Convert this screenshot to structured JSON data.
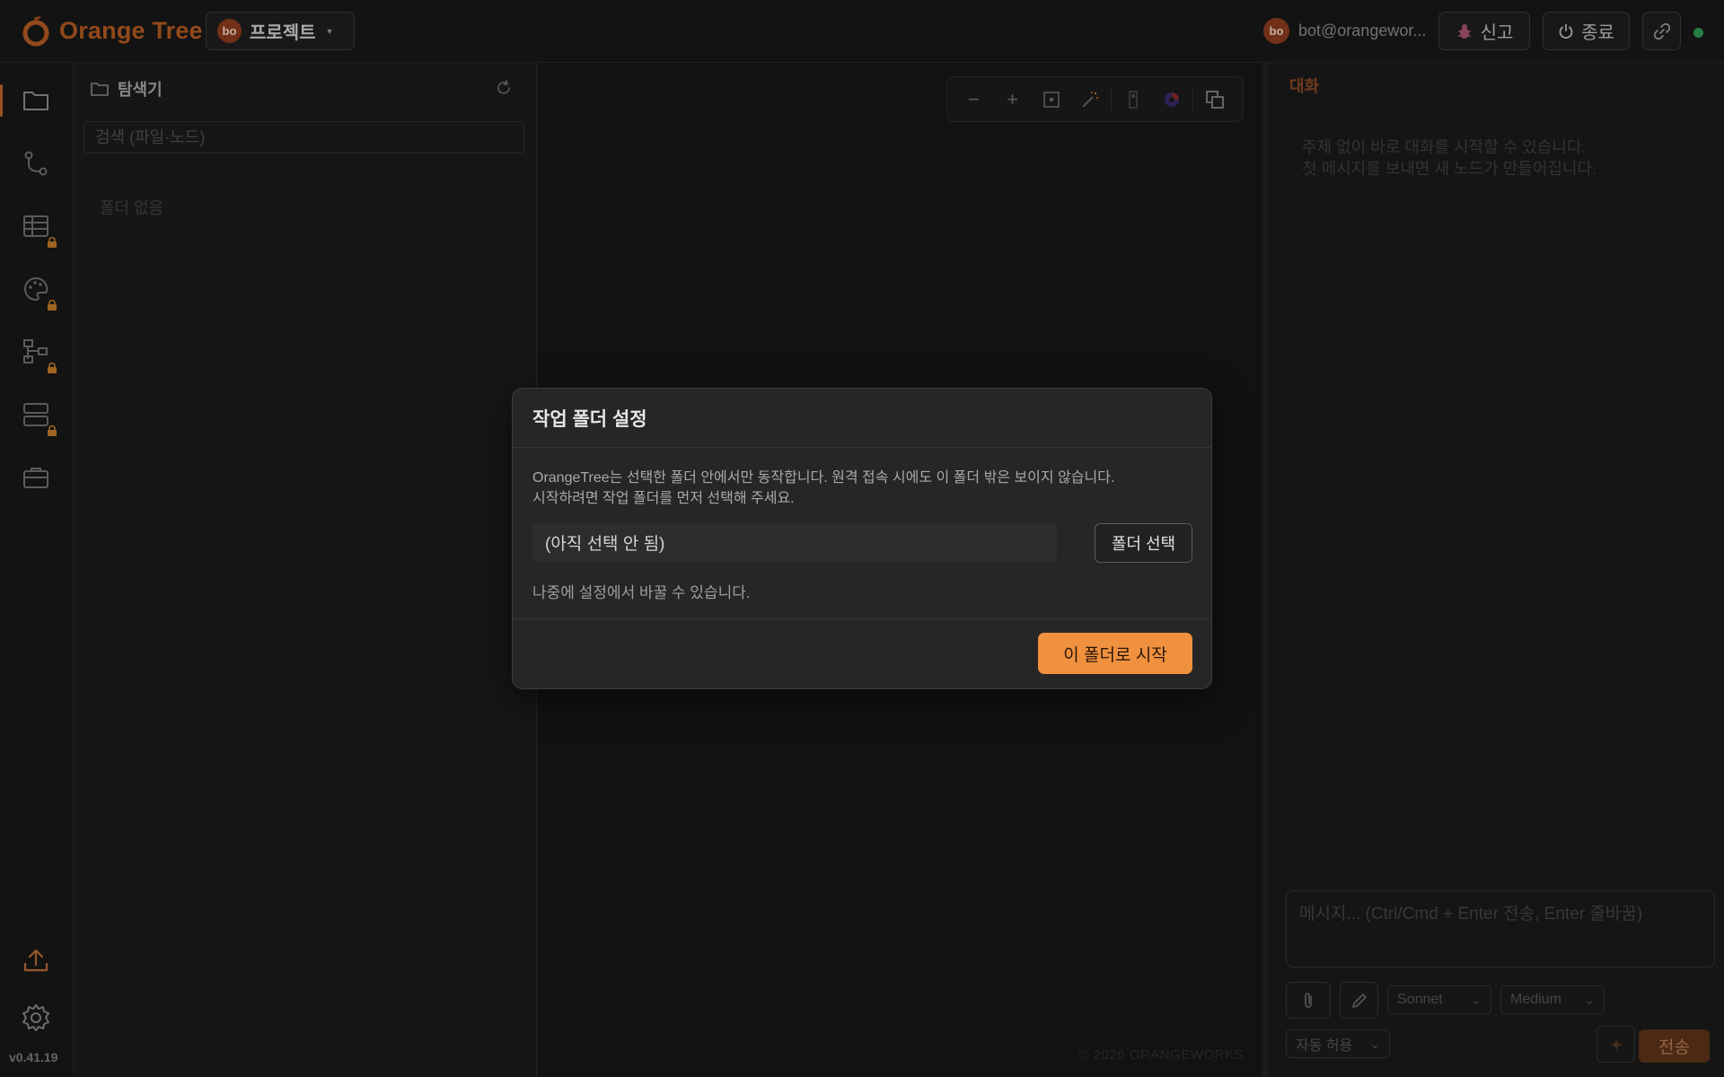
{
  "app": {
    "title": "Orange Tree",
    "version": "v0.41.19"
  },
  "header": {
    "project_avatar": "bo",
    "project_label": "프로젝트",
    "user_avatar": "bo",
    "user_email": "bot@orangewor...",
    "report_label": "신고",
    "exit_label": "종료",
    "status_color": "#2e9a55",
    "accent_color": "#b35a22"
  },
  "rail": {
    "items": [
      "folder-icon",
      "branch-icon",
      "table-icon",
      "palette-icon",
      "diagram-icon",
      "server-icon",
      "briefcase-icon"
    ],
    "bottom": [
      "upload-icon",
      "gear-icon"
    ]
  },
  "explorer": {
    "title": "탐색기",
    "search_placeholder": "검색 (파일·노드)",
    "empty_text": "폴더 없음"
  },
  "canvas": {
    "copyright": "© 2026 ORANGEWORKS"
  },
  "chat": {
    "title": "대화",
    "hint_line1": "주제 없이 바로 대화를 시작할 수 있습니다.",
    "hint_line2": "첫 메시지를 보내면 새 노드가 만들어집니다.",
    "input_placeholder": "메시지... (Ctrl/Cmd + Enter 전송, Enter 줄바꿈)",
    "model_value": "Sonnet",
    "effort_value": "Medium",
    "permission_value": "자동 허용",
    "send_label": "전송"
  },
  "modal": {
    "title": "작업 폴더 설정",
    "desc_line1": "OrangeTree는 선택한 폴더 안에서만 동작합니다. 원격 접속 시에도 이 폴더 밖은 보이지 않습니다.",
    "desc_line2": "시작하려면 작업 폴더를 먼저 선택해 주세요.",
    "path_value": "(아직 선택 안 됨)",
    "pick_label": "폴더 선택",
    "note": "나중에 설정에서 바꿀 수 있습니다.",
    "start_label": "이 폴더로 시작",
    "start_color": "#f0913f"
  }
}
